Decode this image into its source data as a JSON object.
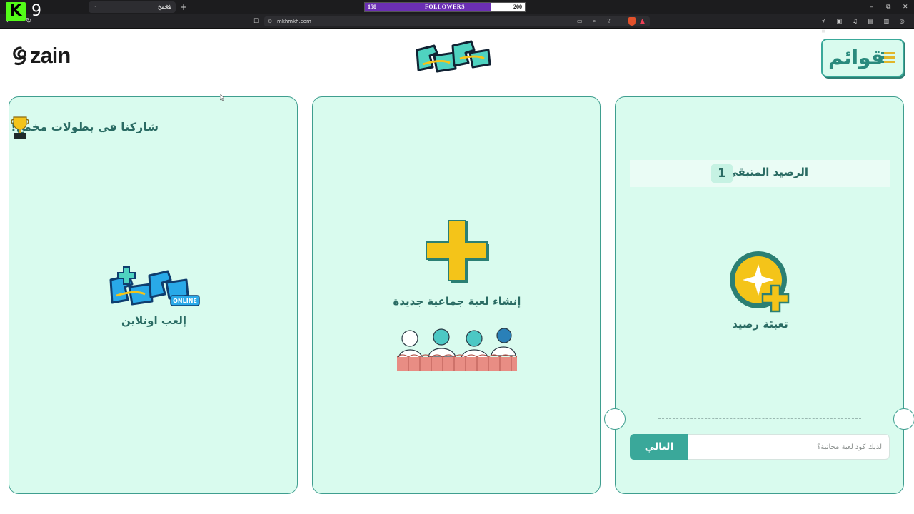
{
  "browser": {
    "tab_title": "مخمخ",
    "tab_dot": "·",
    "tab_close": "×",
    "new_tab": "+",
    "url": "mkhmkh.com",
    "kick_count": "9",
    "followers_widget": {
      "current": "158",
      "label": "FOLLOWERS",
      "goal": "200",
      "progress_fraction": 0.79
    }
  },
  "header": {
    "brand_name": "zain",
    "menu_label": "قوائم"
  },
  "cards": {
    "tournament": {
      "title": "شاركنا في بطولات مخمخ!",
      "online_badge": "ONLINE",
      "play_online_label": "إلعب اونلاين"
    },
    "create_game": {
      "label": "إنشاء لعبة جماعية جديدة"
    },
    "balance": {
      "remaining_label": "الرصيد المتبقي",
      "remaining_value": "1",
      "recharge_label": "تعبئة رصيد",
      "promo_placeholder": "لديك كود لعبة مجانية؟",
      "next_button": "التالي"
    }
  },
  "colors": {
    "card_bg": "#d9fbee",
    "card_border": "#3f9e8f",
    "accent_teal": "#3aa89a",
    "accent_yellow": "#f4c419",
    "text_teal": "#2a6b63",
    "followers_purple": "#6b2fb3",
    "kick_green": "#53fc18"
  }
}
